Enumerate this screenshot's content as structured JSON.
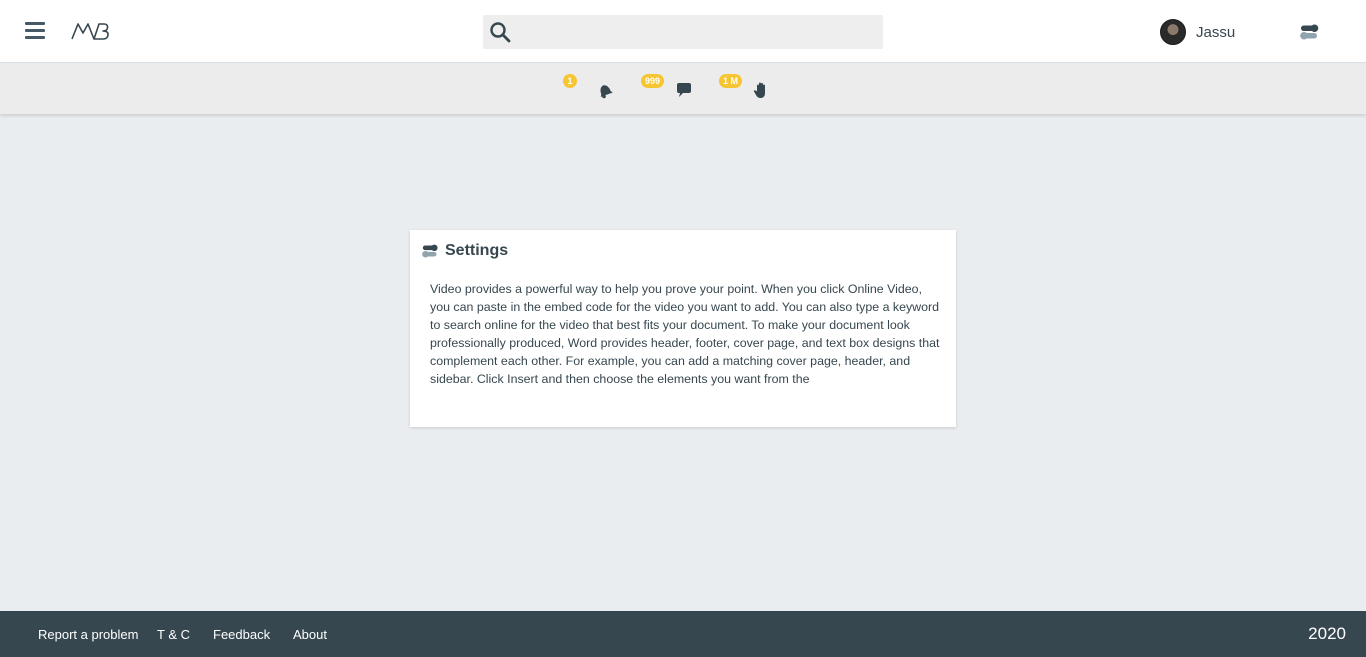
{
  "header": {
    "search_placeholder": "",
    "user_name": "Jassu"
  },
  "notifications": [
    {
      "count": "1",
      "icon": "bell-icon"
    },
    {
      "count": "999",
      "icon": "chat-bubble-icon"
    },
    {
      "count": "1 M",
      "icon": "hand-wave-icon"
    }
  ],
  "card": {
    "title": "Settings",
    "body": "Video provides a powerful way to help you prove your point. When you click Online Video, you can paste in the embed code for the video you want to add. You can also type a keyword to search online for the video that best fits your document. To make your document look professionally produced, Word provides header, footer, cover page, and text box designs that complement each other. For example, you can add a matching cover page, header, and sidebar. Click Insert and then choose the elements you want from the"
  },
  "footer": {
    "links": [
      "Report a problem",
      "T & C",
      "Feedback",
      "About"
    ],
    "year": "2020"
  },
  "colors": {
    "footer_bg": "#37474f",
    "badge": "#f6c532",
    "page_bg": "#eaedf0"
  }
}
